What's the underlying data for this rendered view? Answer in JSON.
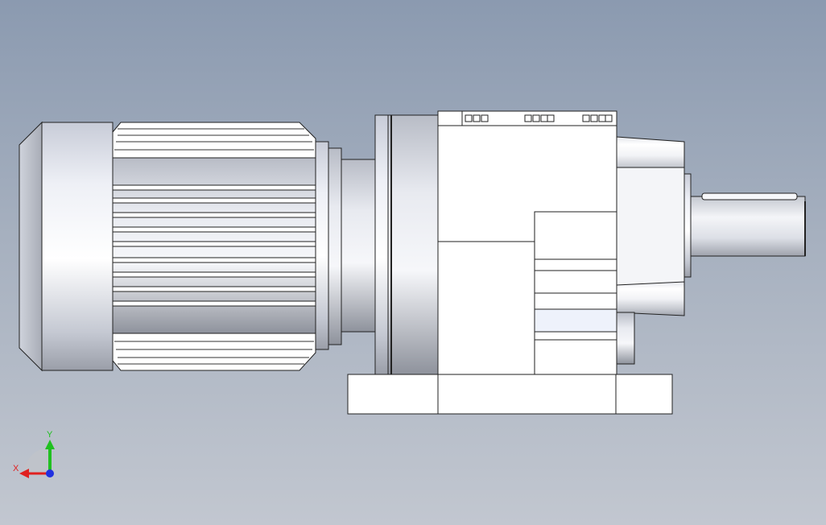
{
  "viewport": {
    "view": "front",
    "background_top": "#8b9ab0",
    "background_bottom": "#c2c7d0"
  },
  "model": {
    "name": "helical-gear-motor",
    "parts": [
      "motor-end-cap",
      "motor-fan-cover",
      "motor-body",
      "motor-flange",
      "gearbox-housing",
      "foot-base",
      "output-bearing-housing",
      "output-shaft"
    ]
  },
  "triad": {
    "x_label": "X",
    "y_label": "Y",
    "x_color": "#e02020",
    "y_color": "#20c020",
    "z_color": "#2030e0"
  }
}
